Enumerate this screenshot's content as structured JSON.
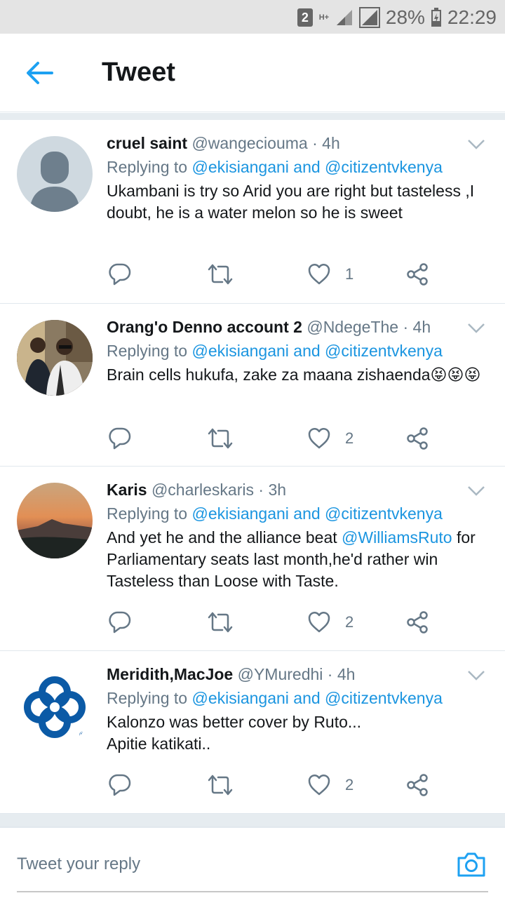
{
  "status_bar": {
    "sim_badge": "2",
    "network": "H+",
    "battery": "28%",
    "time": "22:29"
  },
  "header": {
    "title": "Tweet"
  },
  "tweets": [
    {
      "name": "cruel saint",
      "handle": "@wangeciouma",
      "time": "· 4h",
      "replying_prefix": "Replying to ",
      "replying_to": "@ekisiangani and @citizentvkenya",
      "text": "Ukambani is try so Arid you are right but tasteless ,I doubt, he is a water melon so he is sweet",
      "likes": "1"
    },
    {
      "name": "Orang'o Denno account 2",
      "handle": "@NdegeThe",
      "time": "· 4h",
      "replying_prefix": "Replying to ",
      "replying_to": "@ekisiangani and @citizentvkenya",
      "text": "Brain cells hukufa, zake za maana zishaenda😝😝😝",
      "likes": "2"
    },
    {
      "name": "Karis",
      "handle": "@charleskaris",
      "time": "· 3h",
      "replying_prefix": "Replying to ",
      "replying_to": "@ekisiangani and @citizentvkenya",
      "text_before": "And yet he and the alliance beat ",
      "mention": "@WilliamsRuto",
      "text_after": " for Parliamentary seats last month,he'd rather win Tasteless than Loose with Taste.",
      "likes": "2"
    },
    {
      "name": "Meridith,MacJoe",
      "handle": "@YMuredhi",
      "time": "· 4h",
      "replying_prefix": "Replying to ",
      "replying_to": "@ekisiangani and @citizentvkenya",
      "text_line1": "Kalonzo was better cover by Ruto...",
      "text_line2": "Apitie katikati..",
      "likes": "2"
    }
  ],
  "composer": {
    "placeholder": "Tweet your reply"
  },
  "colors": {
    "accent": "#1da1f2",
    "link": "#1b95e0",
    "muted": "#657786",
    "icon": "#657786"
  },
  "icons": [
    "back-arrow-icon",
    "chevron-down-icon",
    "reply-icon",
    "retweet-icon",
    "like-icon",
    "share-icon",
    "camera-icon"
  ]
}
